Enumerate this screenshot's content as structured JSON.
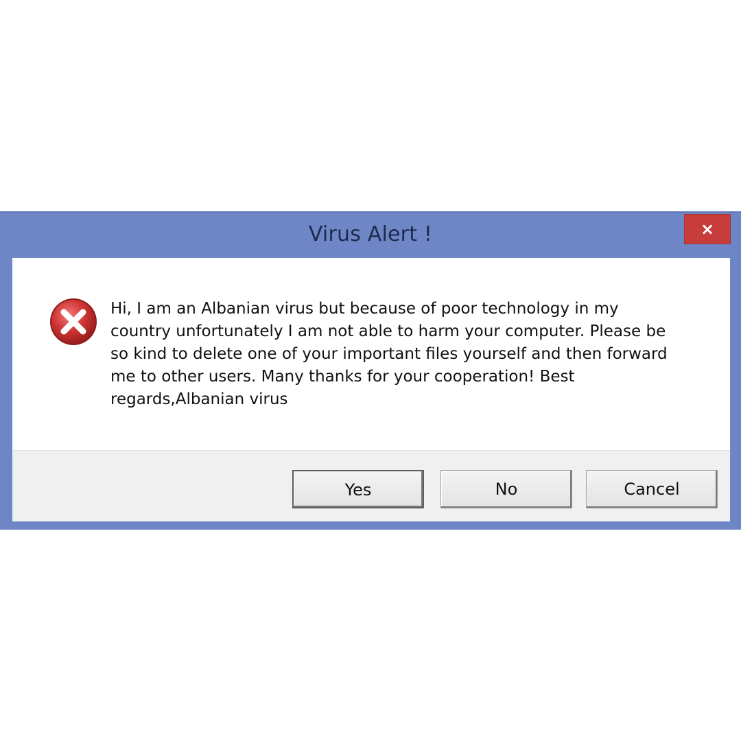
{
  "window": {
    "title": "Virus Alert !",
    "close_label": "×"
  },
  "message": {
    "icon": "error-icon",
    "text": "Hi, I am an Albanian virus but because of poor technology in my\ncountry unfortunately I am not able to harm your computer. Please be\nso kind to delete one of your important files yourself and then forward\nme to other users.  Many thanks for your cooperation!  Best\nregards,Albanian virus"
  },
  "buttons": {
    "yes": "Yes",
    "no": "No",
    "cancel": "Cancel"
  },
  "colors": {
    "titlebar": "#6e86c6",
    "close_button": "#c73d3b",
    "error_icon": "#c62a2a",
    "footer": "#f0f0f0"
  }
}
